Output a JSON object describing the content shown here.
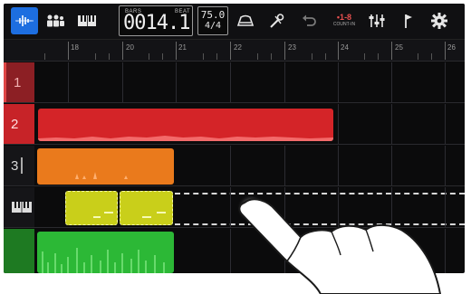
{
  "toolbar": {
    "counter_bars_label": "BARS",
    "counter_beat_label": "BEAT",
    "counter_value": "0014.1",
    "tempo": "75.0",
    "time_signature": "4/4",
    "count_main": "•1-8",
    "count_sub": "COUNT-IN",
    "accent_color": "#1d6ee0"
  },
  "ruler": {
    "labels": [
      "18",
      "20",
      "21",
      "22",
      "23",
      "24",
      "25",
      "26"
    ]
  },
  "tracks": [
    {
      "label": "1",
      "header_color": "#d43b3b"
    },
    {
      "label": "2",
      "header_color": "#d12a2a",
      "region_color": "#d42428"
    },
    {
      "label": "3",
      "header_color": "#e46a17",
      "region_color": "#ea7a1c"
    },
    {
      "label": "",
      "header_icon": "piano-icon",
      "region_color": "#c9cf1a"
    },
    {
      "label": "",
      "header_color": "#2fb52f",
      "region_color": "#2cb836"
    }
  ]
}
